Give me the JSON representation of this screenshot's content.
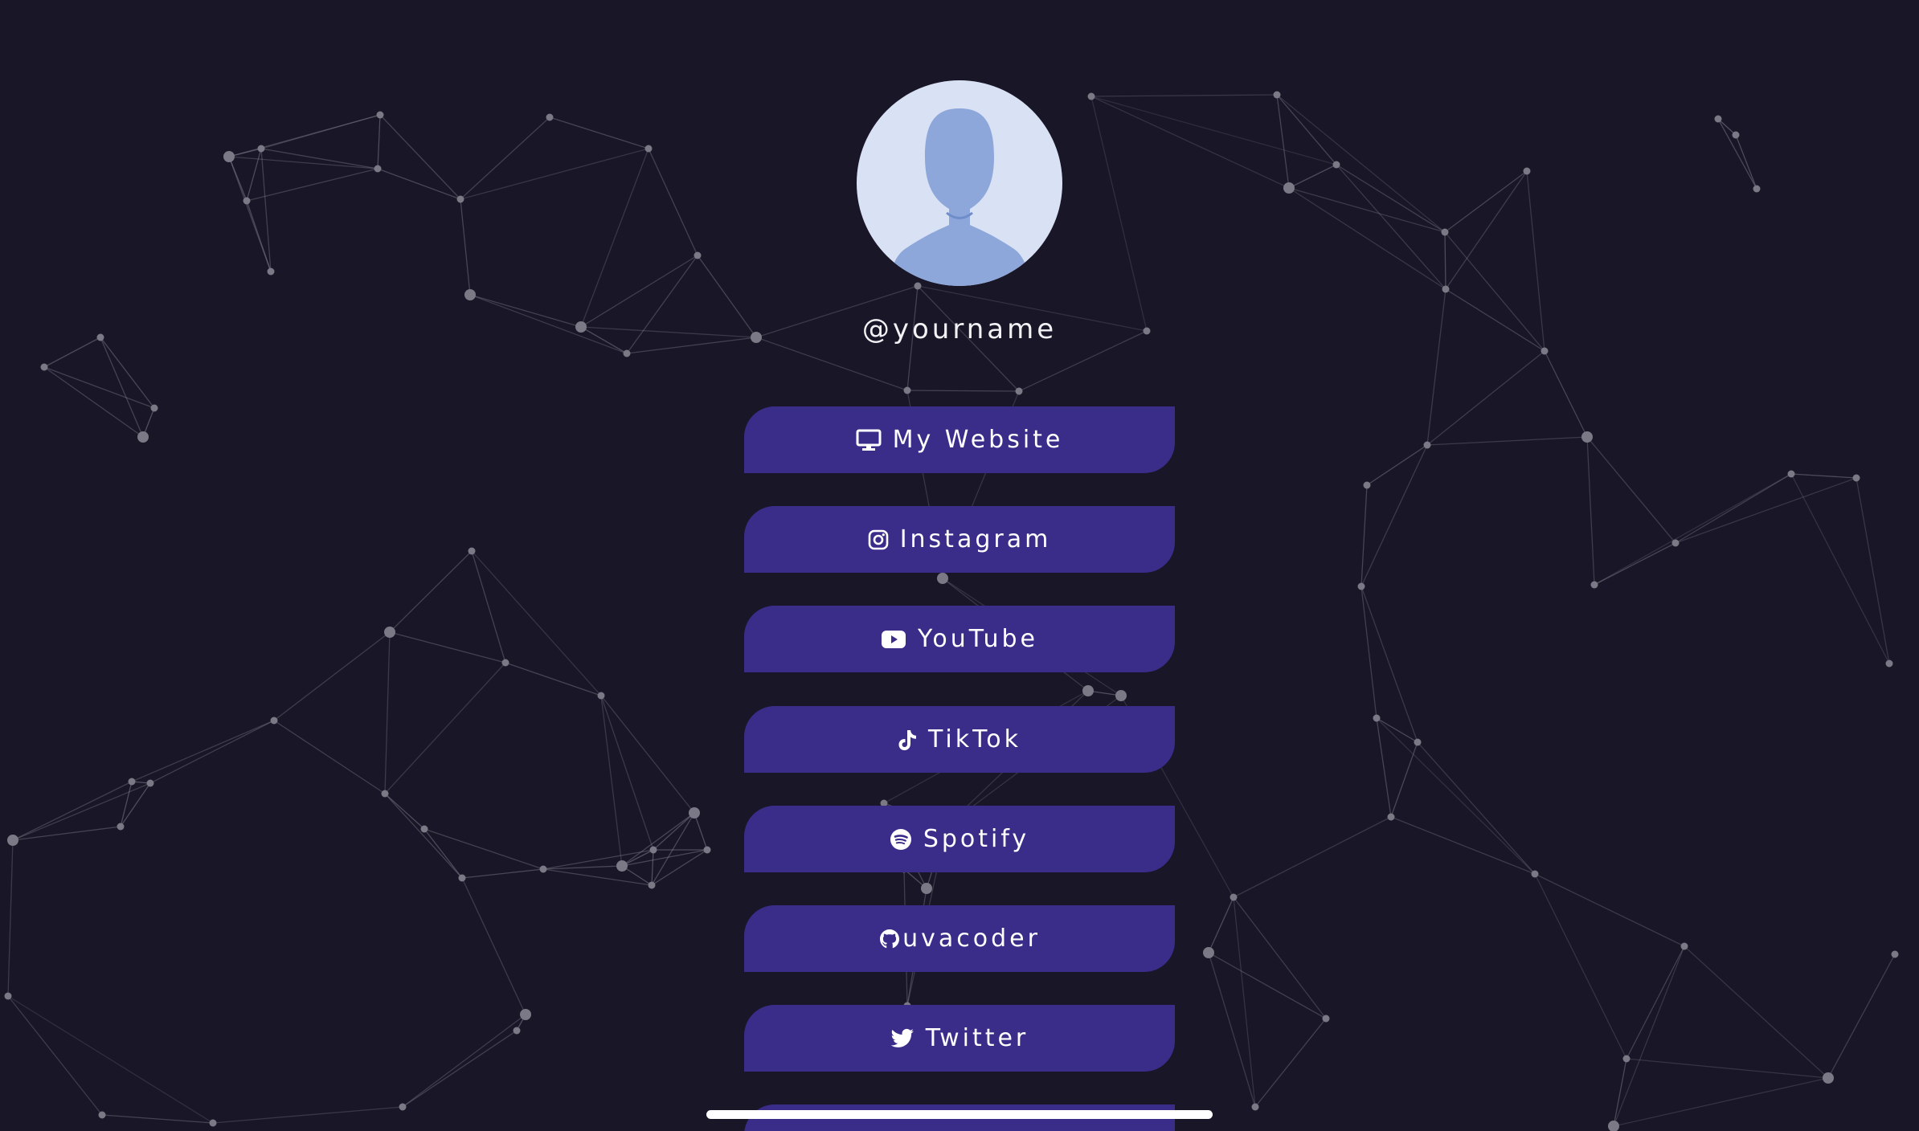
{
  "profile": {
    "username": "@yourname"
  },
  "links": [
    {
      "label": "My Website",
      "icon": "monitor-icon"
    },
    {
      "label": "Instagram",
      "icon": "instagram-icon"
    },
    {
      "label": "YouTube",
      "icon": "youtube-icon"
    },
    {
      "label": "TikTok",
      "icon": "tiktok-icon"
    },
    {
      "label": "Spotify",
      "icon": "spotify-icon"
    },
    {
      "label": "uvacoder",
      "icon": "github-icon"
    },
    {
      "label": "Twitter",
      "icon": "twitter-icon"
    }
  ],
  "colors": {
    "background": "#181627",
    "button": "#3a2d8a",
    "text": "#ffffff",
    "avatar_bg": "#d9e2f4",
    "avatar_figure": "#8ea7da",
    "network": "#8a8896"
  }
}
